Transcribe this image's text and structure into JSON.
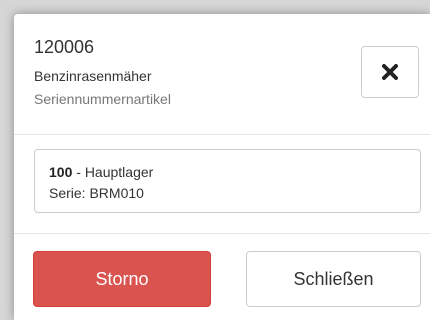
{
  "dialog": {
    "article_number": "120006",
    "article_name": "Benzinrasenmäher",
    "article_type": "Seriennummernartikel",
    "close_icon": "close-x-icon"
  },
  "stock": {
    "warehouse_number": "100",
    "warehouse_separator": " - ",
    "warehouse_name": "Hauptlager",
    "serial_line": "Serie: BRM010"
  },
  "footer": {
    "storno_label": "Storno",
    "close_label": "Schließen"
  },
  "colors": {
    "danger": "#d9534f",
    "border": "#cccccc",
    "muted_text": "#777777"
  }
}
